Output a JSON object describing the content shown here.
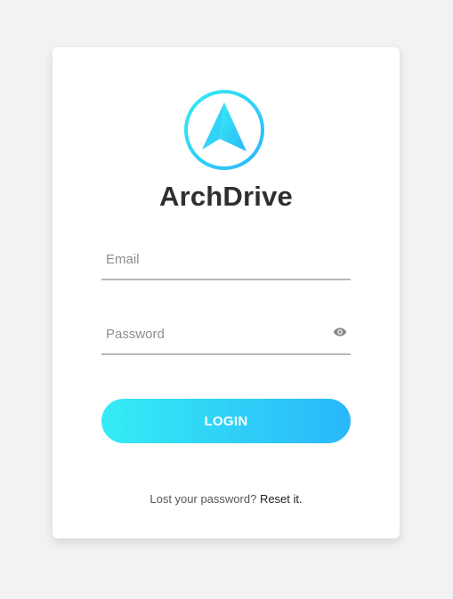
{
  "brand": {
    "name": "ArchDrive",
    "logo_icon": "arrow-navigation-icon",
    "logo_colors": [
      "#35ecf4",
      "#2ab7fa"
    ]
  },
  "form": {
    "email_placeholder": "Email",
    "email_value": "",
    "password_placeholder": "Password",
    "password_value": "",
    "password_toggle_icon": "eye-icon",
    "login_label": "LOGIN"
  },
  "footer": {
    "prompt": "Lost your password?",
    "reset_link": "Reset it."
  },
  "colors": {
    "background": "#f2f2f2",
    "card": "#ffffff",
    "button_gradient_start": "#35ecf4",
    "button_gradient_end": "#2ab7fa",
    "title": "#2f2f2f"
  }
}
